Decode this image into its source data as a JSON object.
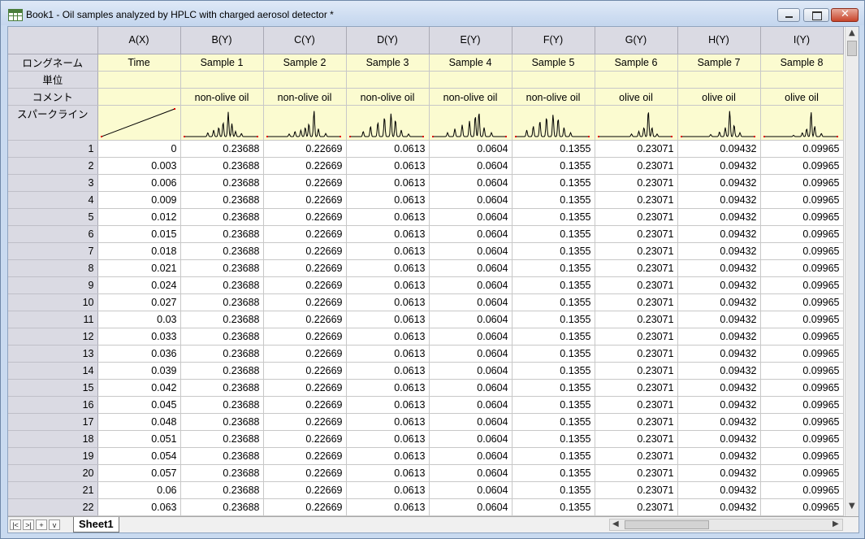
{
  "window": {
    "title": "Book1 - Oil samples analyzed by HPLC with charged aerosol detector *",
    "icon": "worksheet-grid-icon",
    "buttons": [
      "minimize-icon",
      "restore-icon",
      "close-icon"
    ]
  },
  "columns": [
    {
      "header": "A(X)",
      "long_name": "Time",
      "unit": "",
      "comment": "",
      "sparkline": "ramp"
    },
    {
      "header": "B(Y)",
      "long_name": "Sample 1",
      "unit": "",
      "comment": "non-olive oil",
      "sparkline": "peaks1"
    },
    {
      "header": "C(Y)",
      "long_name": "Sample 2",
      "unit": "",
      "comment": "non-olive oil",
      "sparkline": "peaks2"
    },
    {
      "header": "D(Y)",
      "long_name": "Sample 3",
      "unit": "",
      "comment": "non-olive oil",
      "sparkline": "peaks3"
    },
    {
      "header": "E(Y)",
      "long_name": "Sample 4",
      "unit": "",
      "comment": "non-olive oil",
      "sparkline": "peaks4"
    },
    {
      "header": "F(Y)",
      "long_name": "Sample 5",
      "unit": "",
      "comment": "non-olive oil",
      "sparkline": "peaks5"
    },
    {
      "header": "G(Y)",
      "long_name": "Sample 6",
      "unit": "",
      "comment": "olive oil",
      "sparkline": "olive1"
    },
    {
      "header": "H(Y)",
      "long_name": "Sample 7",
      "unit": "",
      "comment": "olive oil",
      "sparkline": "olive2"
    },
    {
      "header": "I(Y)",
      "long_name": "Sample 8",
      "unit": "",
      "comment": "olive oil",
      "sparkline": "olive3"
    }
  ],
  "row_labels": {
    "long_name": "ロングネーム",
    "unit": "単位",
    "comment": "コメント",
    "sparkline": "スパークライン"
  },
  "rows": [
    [
      "1",
      "0",
      "0.23688",
      "0.22669",
      "0.0613",
      "0.0604",
      "0.1355",
      "0.23071",
      "0.09432",
      "0.09965"
    ],
    [
      "2",
      "0.003",
      "0.23688",
      "0.22669",
      "0.0613",
      "0.0604",
      "0.1355",
      "0.23071",
      "0.09432",
      "0.09965"
    ],
    [
      "3",
      "0.006",
      "0.23688",
      "0.22669",
      "0.0613",
      "0.0604",
      "0.1355",
      "0.23071",
      "0.09432",
      "0.09965"
    ],
    [
      "4",
      "0.009",
      "0.23688",
      "0.22669",
      "0.0613",
      "0.0604",
      "0.1355",
      "0.23071",
      "0.09432",
      "0.09965"
    ],
    [
      "5",
      "0.012",
      "0.23688",
      "0.22669",
      "0.0613",
      "0.0604",
      "0.1355",
      "0.23071",
      "0.09432",
      "0.09965"
    ],
    [
      "6",
      "0.015",
      "0.23688",
      "0.22669",
      "0.0613",
      "0.0604",
      "0.1355",
      "0.23071",
      "0.09432",
      "0.09965"
    ],
    [
      "7",
      "0.018",
      "0.23688",
      "0.22669",
      "0.0613",
      "0.0604",
      "0.1355",
      "0.23071",
      "0.09432",
      "0.09965"
    ],
    [
      "8",
      "0.021",
      "0.23688",
      "0.22669",
      "0.0613",
      "0.0604",
      "0.1355",
      "0.23071",
      "0.09432",
      "0.09965"
    ],
    [
      "9",
      "0.024",
      "0.23688",
      "0.22669",
      "0.0613",
      "0.0604",
      "0.1355",
      "0.23071",
      "0.09432",
      "0.09965"
    ],
    [
      "10",
      "0.027",
      "0.23688",
      "0.22669",
      "0.0613",
      "0.0604",
      "0.1355",
      "0.23071",
      "0.09432",
      "0.09965"
    ],
    [
      "11",
      "0.03",
      "0.23688",
      "0.22669",
      "0.0613",
      "0.0604",
      "0.1355",
      "0.23071",
      "0.09432",
      "0.09965"
    ],
    [
      "12",
      "0.033",
      "0.23688",
      "0.22669",
      "0.0613",
      "0.0604",
      "0.1355",
      "0.23071",
      "0.09432",
      "0.09965"
    ],
    [
      "13",
      "0.036",
      "0.23688",
      "0.22669",
      "0.0613",
      "0.0604",
      "0.1355",
      "0.23071",
      "0.09432",
      "0.09965"
    ],
    [
      "14",
      "0.039",
      "0.23688",
      "0.22669",
      "0.0613",
      "0.0604",
      "0.1355",
      "0.23071",
      "0.09432",
      "0.09965"
    ],
    [
      "15",
      "0.042",
      "0.23688",
      "0.22669",
      "0.0613",
      "0.0604",
      "0.1355",
      "0.23071",
      "0.09432",
      "0.09965"
    ],
    [
      "16",
      "0.045",
      "0.23688",
      "0.22669",
      "0.0613",
      "0.0604",
      "0.1355",
      "0.23071",
      "0.09432",
      "0.09965"
    ],
    [
      "17",
      "0.048",
      "0.23688",
      "0.22669",
      "0.0613",
      "0.0604",
      "0.1355",
      "0.23071",
      "0.09432",
      "0.09965"
    ],
    [
      "18",
      "0.051",
      "0.23688",
      "0.22669",
      "0.0613",
      "0.0604",
      "0.1355",
      "0.23071",
      "0.09432",
      "0.09965"
    ],
    [
      "19",
      "0.054",
      "0.23688",
      "0.22669",
      "0.0613",
      "0.0604",
      "0.1355",
      "0.23071",
      "0.09432",
      "0.09965"
    ],
    [
      "20",
      "0.057",
      "0.23688",
      "0.22669",
      "0.0613",
      "0.0604",
      "0.1355",
      "0.23071",
      "0.09432",
      "0.09965"
    ],
    [
      "21",
      "0.06",
      "0.23688",
      "0.22669",
      "0.0613",
      "0.0604",
      "0.1355",
      "0.23071",
      "0.09432",
      "0.09965"
    ],
    [
      "22",
      "0.063",
      "0.23688",
      "0.22669",
      "0.0613",
      "0.0604",
      "0.1355",
      "0.23071",
      "0.09432",
      "0.09965"
    ]
  ],
  "sheet_tabs": [
    "Sheet1"
  ],
  "tab_nav": [
    "|<",
    ">|",
    "+",
    "v"
  ],
  "colors": {
    "header_bg": "#dadae3",
    "meta_bg": "#fbfbd0",
    "sparkline": "#000000",
    "sparkline_endpoint": "#e00000"
  }
}
